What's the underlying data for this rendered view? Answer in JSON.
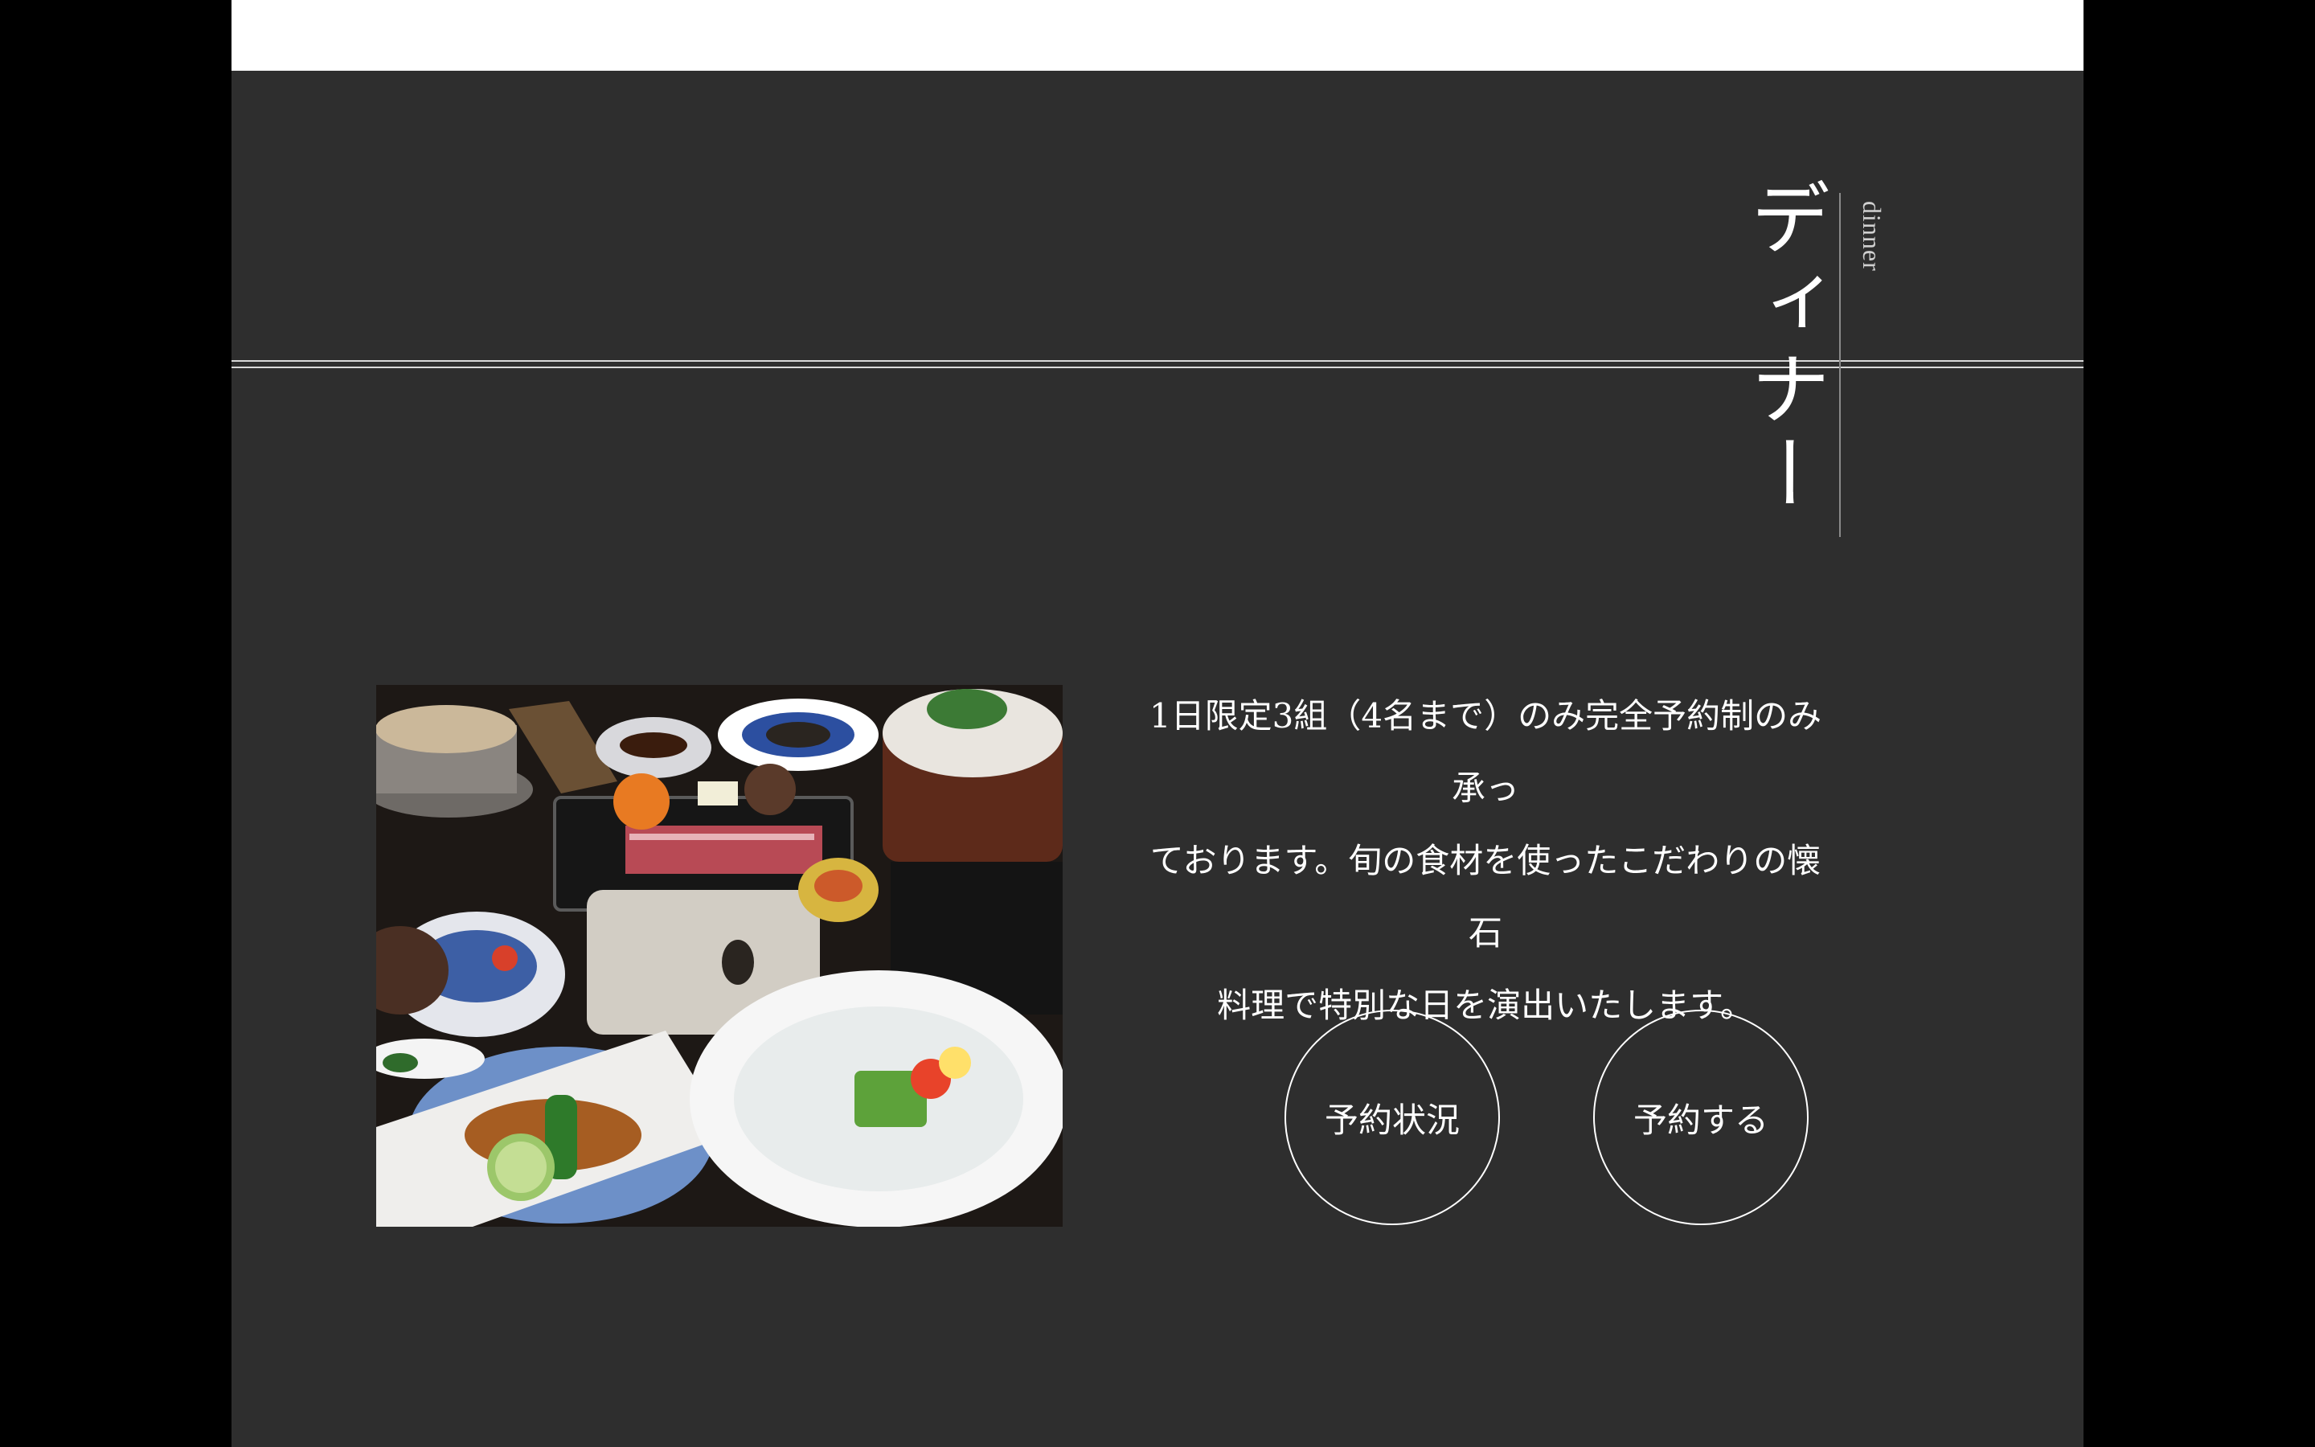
{
  "section": {
    "title": "ディナー",
    "subtitle": "dinner"
  },
  "photo": {
    "icon": "dinner-course-photo"
  },
  "description": {
    "lines": [
      "1日限定3組（4名まで）のみ完全予約制のみ承っ",
      "ております。旬の食材を使ったこだわりの懐石",
      "料理で特別な日を演出いたします。"
    ]
  },
  "buttons": {
    "status_label": "予約状況",
    "reserve_label": "予約する"
  },
  "colors": {
    "background": "#2e2e2e",
    "text": "#ffffff",
    "outer": "#000000"
  }
}
